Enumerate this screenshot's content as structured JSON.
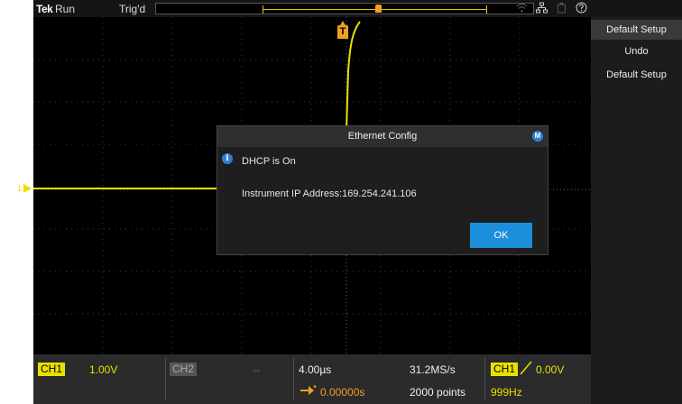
{
  "topbar": {
    "brand": "Tek",
    "run_state": "Run",
    "trigger_state": "Trig'd"
  },
  "display": {
    "trigger_marker_label": "T",
    "ch1_level_marker": "1"
  },
  "dialog": {
    "title": "Ethernet Config",
    "badge": "M",
    "info_glyph": "i",
    "dhcp_status": "DHCP is On",
    "ip_line": "Instrument IP Address:169.254.241.106",
    "ok_label": "OK"
  },
  "readout": {
    "ch1_label": "CH1",
    "ch1_scale": "1.00V",
    "ch2_label": "CH2",
    "ch2_scale": "--",
    "timebase": "4.00µs",
    "delay": "0.00000s",
    "sample_rate": "31.2MS/s",
    "record_length": "2000 points",
    "trigger_source": "CH1",
    "trigger_level": "0.00V",
    "trigger_frequency": "999Hz"
  },
  "side_menu": {
    "title": "Default Setup",
    "items": [
      "Undo",
      "Default Setup"
    ]
  },
  "colors": {
    "ch1": "#e9e000",
    "trigger": "#f0a020",
    "accent_button": "#1b8fd9"
  },
  "icons": {
    "top_right": [
      "wifi-icon",
      "network-icon",
      "usb-icon",
      "help-icon"
    ]
  }
}
